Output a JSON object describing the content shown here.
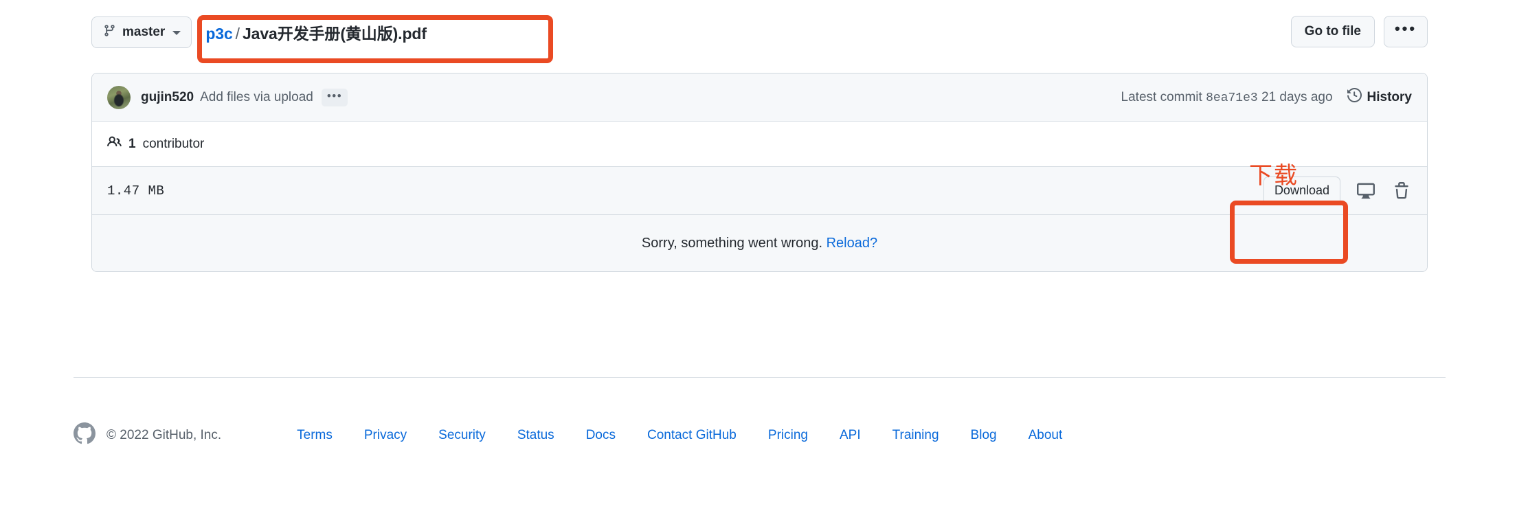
{
  "file_header": {
    "branch": {
      "icon": "git-branch-icon",
      "label": "master",
      "caret_icon": "chevron-down-icon"
    },
    "breadcrumb": {
      "repo": "p3c",
      "separator": "/",
      "filename": "Java开发手册(黄山版).pdf"
    },
    "actions": {
      "go_to_file": "Go to file",
      "kebab": "•••"
    }
  },
  "commit_row": {
    "avatar": "user-avatar",
    "author": "gujin520",
    "message": "Add files via upload",
    "expand_ellipsis": "•••",
    "latest_commit_prefix": "Latest commit",
    "commit_sha": "8ea71e3",
    "commit_time": "21 days ago",
    "history_icon": "history-clock-icon",
    "history_label": "History"
  },
  "contributors_row": {
    "icon": "people-icon",
    "count": "1",
    "label": "contributor",
    "full_text": "1 contributor"
  },
  "file_meta_row": {
    "size": "1.47 MB",
    "download_label": "Download",
    "open_desktop_icon": "device-desktop-icon",
    "delete_icon": "trash-icon"
  },
  "error_row": {
    "message": "Sorry, something went wrong.",
    "reload_link": "Reload?"
  },
  "footer": {
    "logo_icon": "github-mark-icon",
    "copyright": "© 2022 GitHub, Inc.",
    "links": [
      {
        "label": "Terms"
      },
      {
        "label": "Privacy"
      },
      {
        "label": "Security"
      },
      {
        "label": "Status"
      },
      {
        "label": "Docs"
      },
      {
        "label": "Contact GitHub"
      },
      {
        "label": "Pricing"
      },
      {
        "label": "API"
      },
      {
        "label": "Training"
      },
      {
        "label": "Blog"
      },
      {
        "label": "About"
      }
    ]
  },
  "annotations": {
    "color": "#ea4a23",
    "download_label_cn": "下载"
  }
}
